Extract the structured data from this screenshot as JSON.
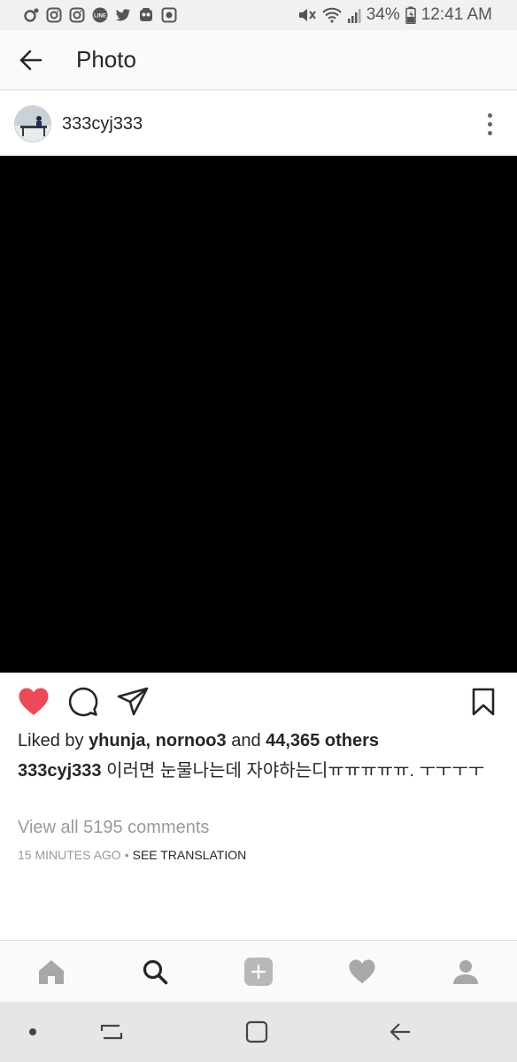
{
  "status_bar": {
    "icons_left": [
      "notification-dot-icon",
      "instagram-icon",
      "instagram-icon",
      "line-icon",
      "twitter-icon",
      "app-icon",
      "camera-icon"
    ],
    "battery": "34%",
    "time": "12:41 AM"
  },
  "app_bar": {
    "title": "Photo"
  },
  "post": {
    "username": "333cyj333",
    "likes_prefix": "Liked by ",
    "liker1": "yhunja",
    "likes_sep": ", ",
    "liker2": "nornoo3",
    "likes_and": " and ",
    "likes_others": "44,365 others",
    "caption_user": "333cyj333",
    "caption_text": " 이러면 눈물나는데 자야하는디ㅠㅠㅠㅠㅠ. ㅜㅜㅜㅜ",
    "view_comments": "View all 5195 comments",
    "time_ago": "15 MINUTES AGO",
    "meta_sep": "•",
    "see_translation": "SEE TRANSLATION",
    "liked": true
  },
  "colors": {
    "heart": "#ed4956",
    "text": "#262626",
    "muted": "#999999"
  }
}
